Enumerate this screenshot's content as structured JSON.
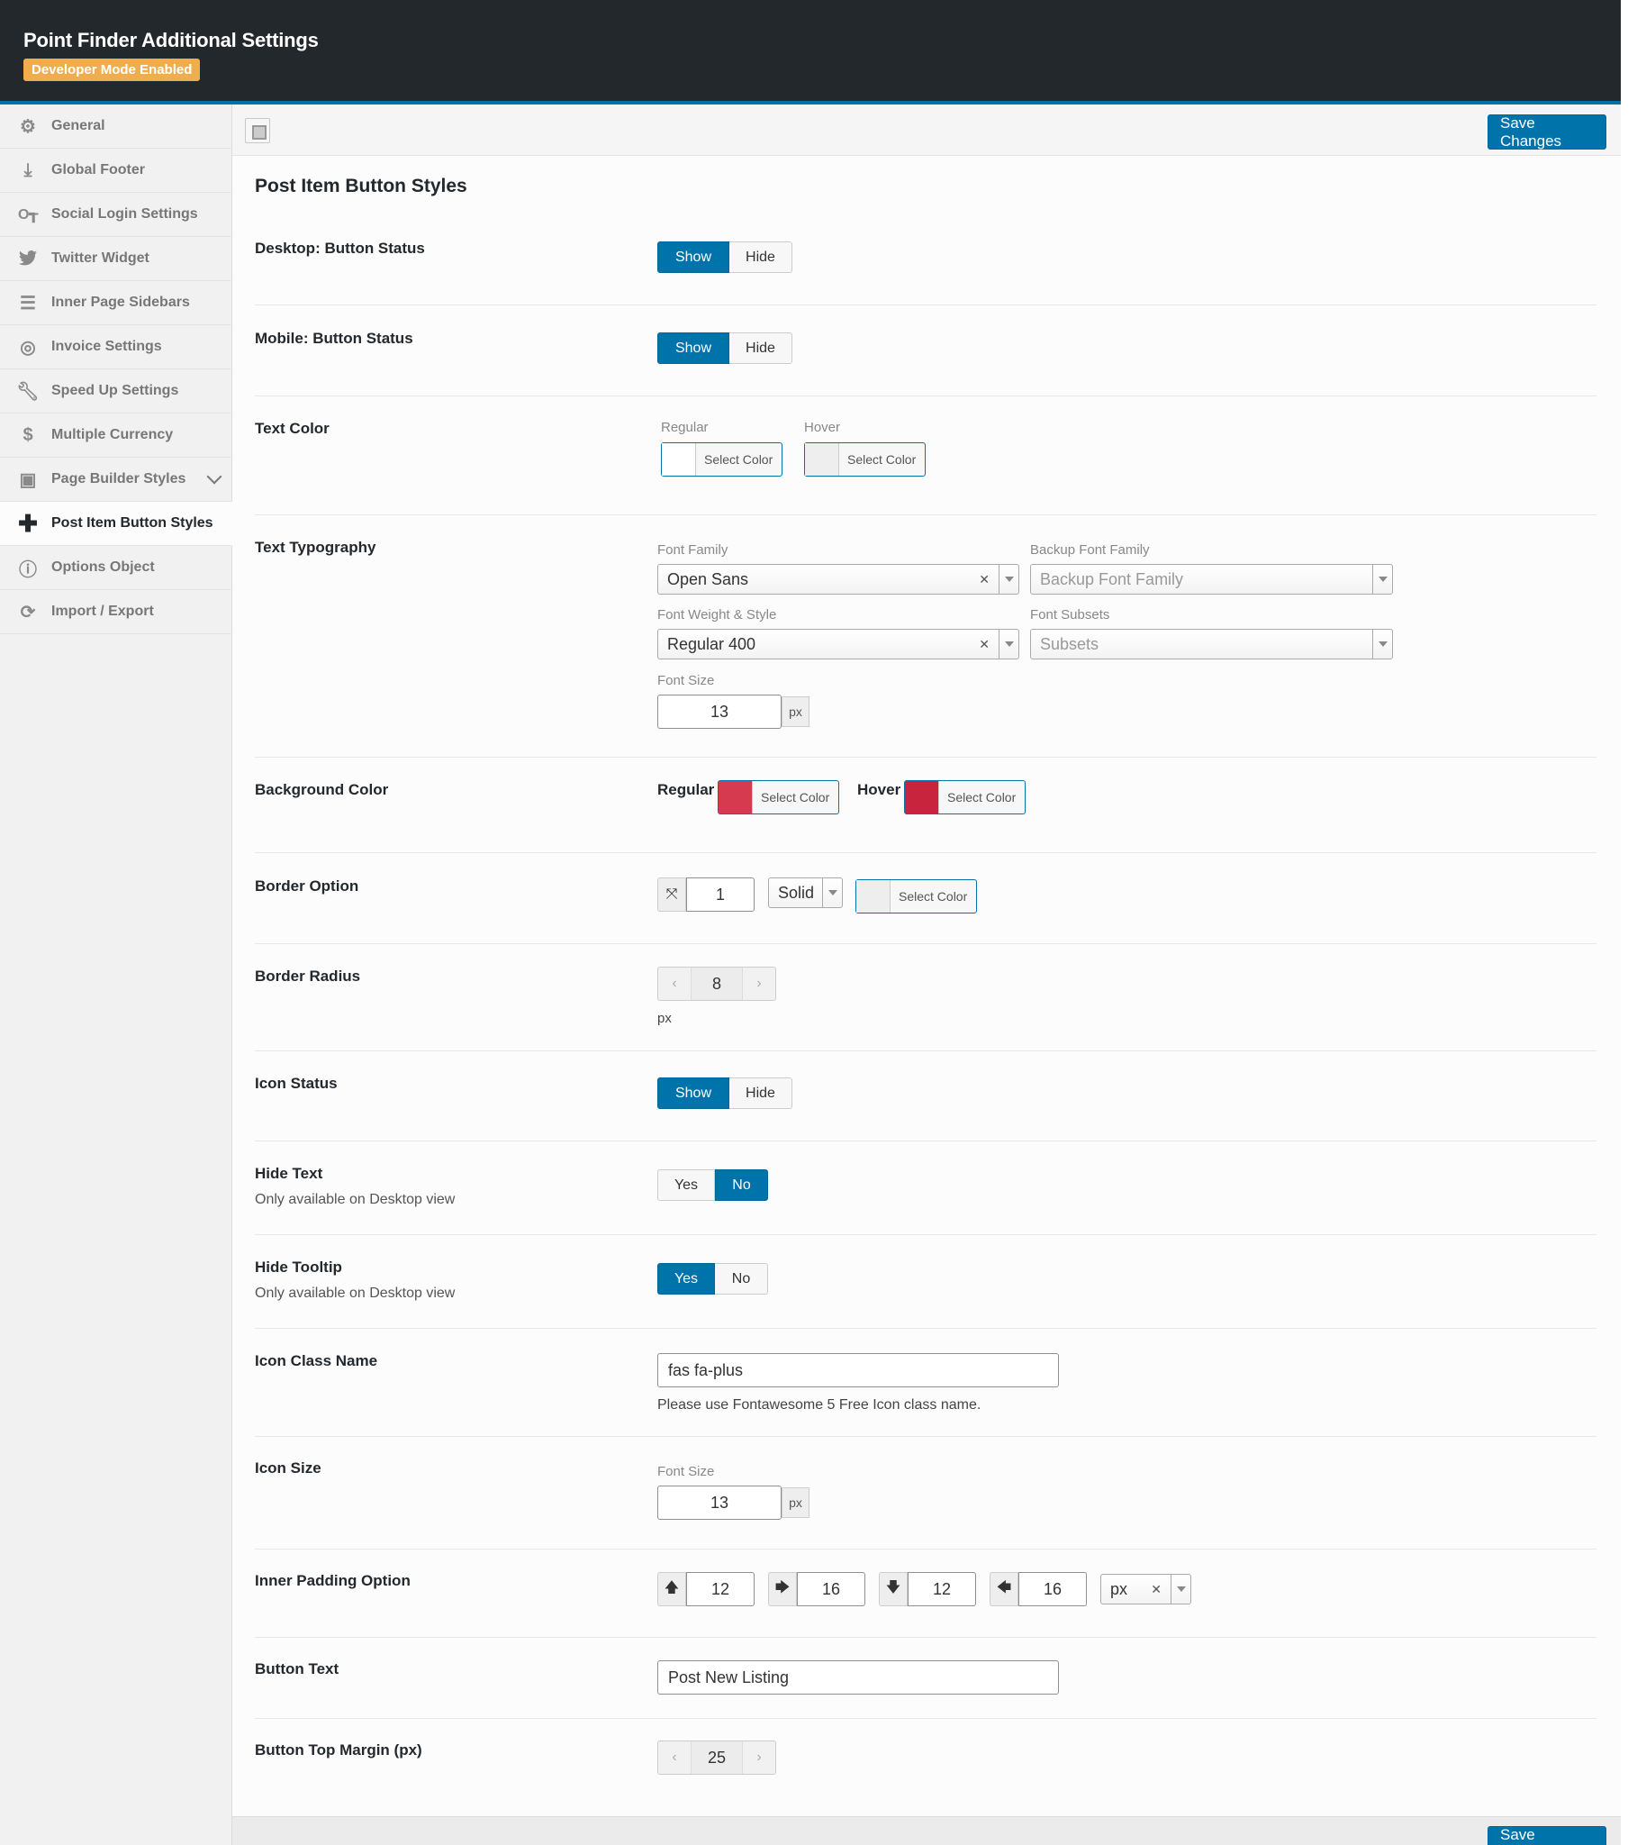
{
  "header": {
    "title": "Point Finder Additional Settings",
    "badge": "Developer Mode Enabled"
  },
  "sidebar": {
    "items": [
      {
        "label": "General",
        "icon": "gears-icon"
      },
      {
        "label": "Global Footer",
        "icon": "download-icon"
      },
      {
        "label": "Social Login Settings",
        "icon": "key-icon"
      },
      {
        "label": "Twitter Widget",
        "icon": "twitter-icon"
      },
      {
        "label": "Inner Page Sidebars",
        "icon": "list-icon"
      },
      {
        "label": "Invoice Settings",
        "icon": "invoice-icon"
      },
      {
        "label": "Speed Up Settings",
        "icon": "wrench-icon"
      },
      {
        "label": "Multiple Currency",
        "icon": "dollar-icon"
      },
      {
        "label": "Page Builder Styles",
        "icon": "layout-icon"
      },
      {
        "label": "Post Item Button Styles",
        "icon": "plus-icon"
      },
      {
        "label": "Options Object",
        "icon": "info-icon"
      },
      {
        "label": "Import / Export",
        "icon": "refresh-icon"
      }
    ]
  },
  "toolbar": {
    "save_label": "Save Changes"
  },
  "main": {
    "section_title": "Post Item Button Styles",
    "desktop_status": {
      "label": "Desktop: Button Status",
      "show": "Show",
      "hide": "Hide",
      "selected": "Show"
    },
    "mobile_status": {
      "label": "Mobile: Button Status",
      "show": "Show",
      "hide": "Hide",
      "selected": "Show"
    },
    "text_color": {
      "label": "Text Color",
      "regular": "Regular",
      "hover": "Hover",
      "select": "Select Color",
      "regular_color": "#ffffff",
      "hover_color": "#eeeeee"
    },
    "typography": {
      "label": "Text Typography",
      "font_family_label": "Font Family",
      "font_family": "Open Sans",
      "backup_label": "Backup Font Family",
      "backup_placeholder": "Backup Font Family",
      "weight_label": "Font Weight & Style",
      "weight": "Regular 400",
      "subsets_label": "Font Subsets",
      "subsets_placeholder": "Subsets",
      "size_label": "Font Size",
      "size": "13",
      "unit": "px"
    },
    "bg_color": {
      "label": "Background Color",
      "regular": "Regular",
      "hover": "Hover",
      "select": "Select Color",
      "regular_color": "#d63a4f",
      "hover_color": "#c8243d"
    },
    "border": {
      "label": "Border Option",
      "width": "1",
      "style": "Solid",
      "select": "Select Color",
      "color": "#eeeeee"
    },
    "border_radius": {
      "label": "Border Radius",
      "value": "8",
      "unit": "px"
    },
    "icon_status": {
      "label": "Icon Status",
      "show": "Show",
      "hide": "Hide",
      "selected": "Show"
    },
    "hide_text": {
      "label": "Hide Text",
      "desc": "Only available on Desktop view",
      "yes": "Yes",
      "no": "No",
      "selected": "No"
    },
    "hide_tooltip": {
      "label": "Hide Tooltip",
      "desc": "Only available on Desktop view",
      "yes": "Yes",
      "no": "No",
      "selected": "Yes"
    },
    "icon_class": {
      "label": "Icon Class Name",
      "value": "fas fa-plus",
      "help": "Please use Fontawesome 5 Free Icon class name."
    },
    "icon_size": {
      "label": "Icon Size",
      "size_label": "Font Size",
      "size": "13",
      "unit": "px"
    },
    "padding": {
      "label": "Inner Padding Option",
      "top": "12",
      "right": "16",
      "bottom": "12",
      "left": "16",
      "unit": "px"
    },
    "button_text": {
      "label": "Button Text",
      "value": "Post New Listing"
    },
    "top_margin": {
      "label": "Button Top Margin (px)",
      "value": "25"
    }
  },
  "footer": {
    "save_label": "Save Changes"
  },
  "colors": {
    "accent": "#0073aa",
    "header_bg": "#23282d",
    "badge": "#f0ad4e"
  }
}
